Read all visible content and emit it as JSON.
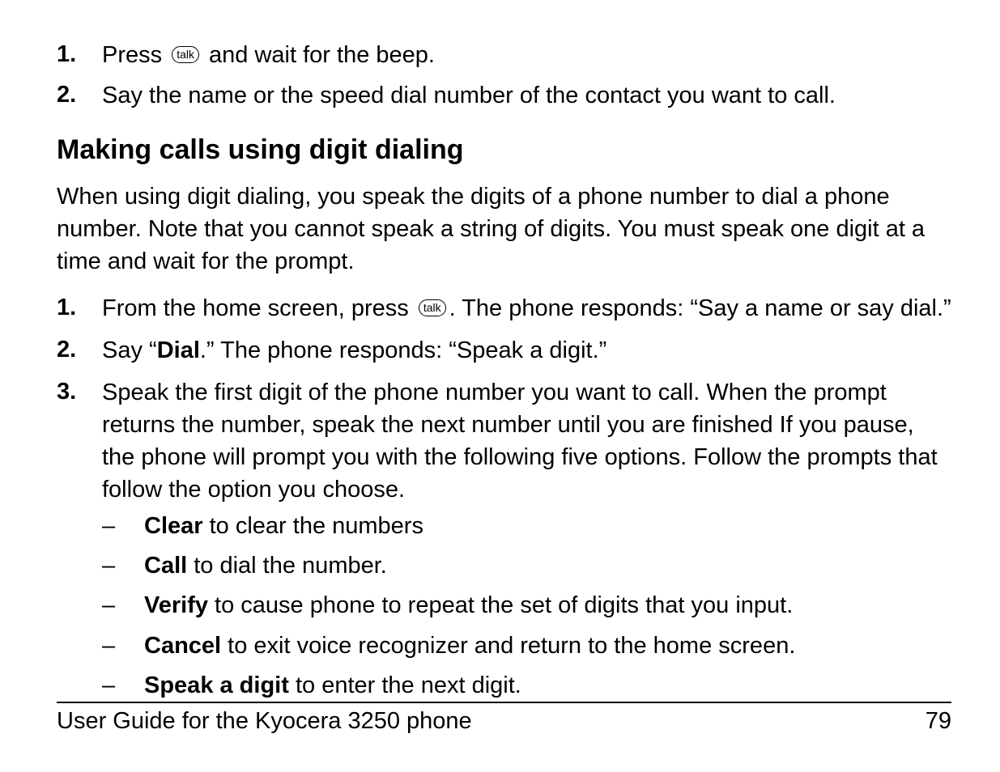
{
  "list1": [
    {
      "num": "1.",
      "before": "Press ",
      "icon": true,
      "after": " and wait for the beep."
    },
    {
      "num": "2.",
      "text": "Say the name or the speed dial number of the contact you want to call."
    }
  ],
  "heading": "Making calls using digit dialing",
  "paragraph": "When using digit dialing, you speak the digits of a phone number to dial a phone number. Note that you cannot speak a string of digits. You must speak one digit at a time and wait for the prompt.",
  "list2": {
    "item1": {
      "num": "1.",
      "before": "From the home screen, press ",
      "after": ". The phone responds: “Say a name or say dial.”"
    },
    "item2": {
      "num": "2.",
      "pre": "Say “",
      "bold": "Dial",
      "post": ".” The phone responds: “Speak a digit.”"
    },
    "item3": {
      "num": "3.",
      "text": "Speak the first digit of the phone number you want to call. When the prompt returns the number, speak the next number until you are finished If you pause, the phone will prompt you with the following five options. Follow the prompts that follow the option you choose.",
      "sub": [
        {
          "bold": "Clear",
          "rest": " to clear the numbers"
        },
        {
          "bold": "Call",
          "rest": " to dial the number."
        },
        {
          "bold": "Verify",
          "rest": " to cause phone to repeat the set of digits that you input."
        },
        {
          "bold": "Cancel",
          "rest": " to exit voice recognizer and return to the home screen."
        },
        {
          "bold": "Speak a digit",
          "rest": " to enter the next digit."
        }
      ]
    }
  },
  "icon_label": "talk",
  "dash": "–",
  "footer": {
    "title": "User Guide for the Kyocera 3250 phone",
    "page": "79"
  }
}
